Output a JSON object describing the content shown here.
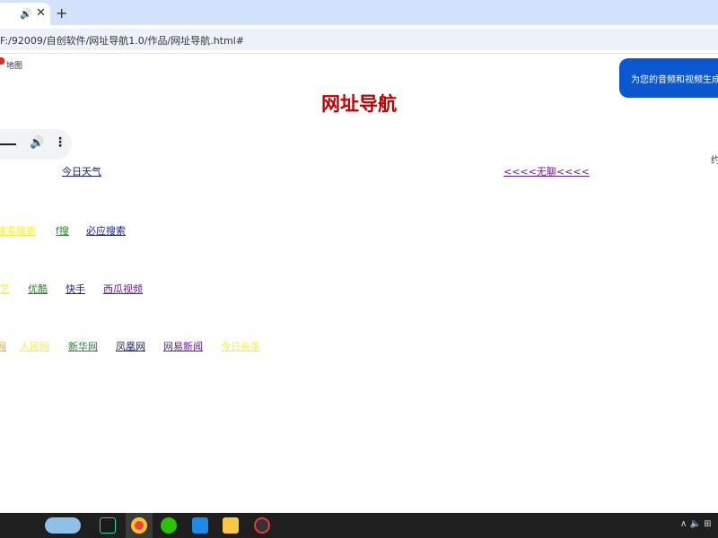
{
  "browser": {
    "tab_audio_icon": "speaker-icon",
    "tab_close": "✕",
    "new_tab": "+",
    "address": "F:/92009/自创软件/网址导航1.0/作品/网址导航.html#"
  },
  "page": {
    "map_link": "地图",
    "toast": "为您的音频和视频生成",
    "title": "网址导航",
    "player": {
      "volume_icon": "🔊",
      "more_icon": "⋮"
    },
    "weather_link": "今日天气",
    "right_banner_link": "<<<<无聊<<<<",
    "right_partial": "约",
    "search_links": [
      "搜索搜索",
      "f搜",
      "必应搜索"
    ],
    "video_links": [
      "艺",
      "优酷",
      "快手",
      "西瓜视频"
    ],
    "news_links": [
      "网",
      "人民网",
      "新华网",
      "凤凰网",
      "网易新闻",
      "今日头条"
    ]
  },
  "colors": {
    "title": "#c00000",
    "toast_bg": "#0b57d0",
    "link_yellow": "#ffeb3b",
    "link_green": "#2e7d32",
    "link_navy": "#1a237e",
    "link_purple": "#6a1b9a",
    "link_orange": "#f9a825"
  },
  "taskbar": {
    "icons": [
      "weather-icon",
      "pycharm-icon",
      "chrome-icon",
      "wechat-icon",
      "feishu-icon",
      "file-explorer-icon",
      "media-player-icon"
    ],
    "tray": "∧ 🔈 ⊞"
  }
}
